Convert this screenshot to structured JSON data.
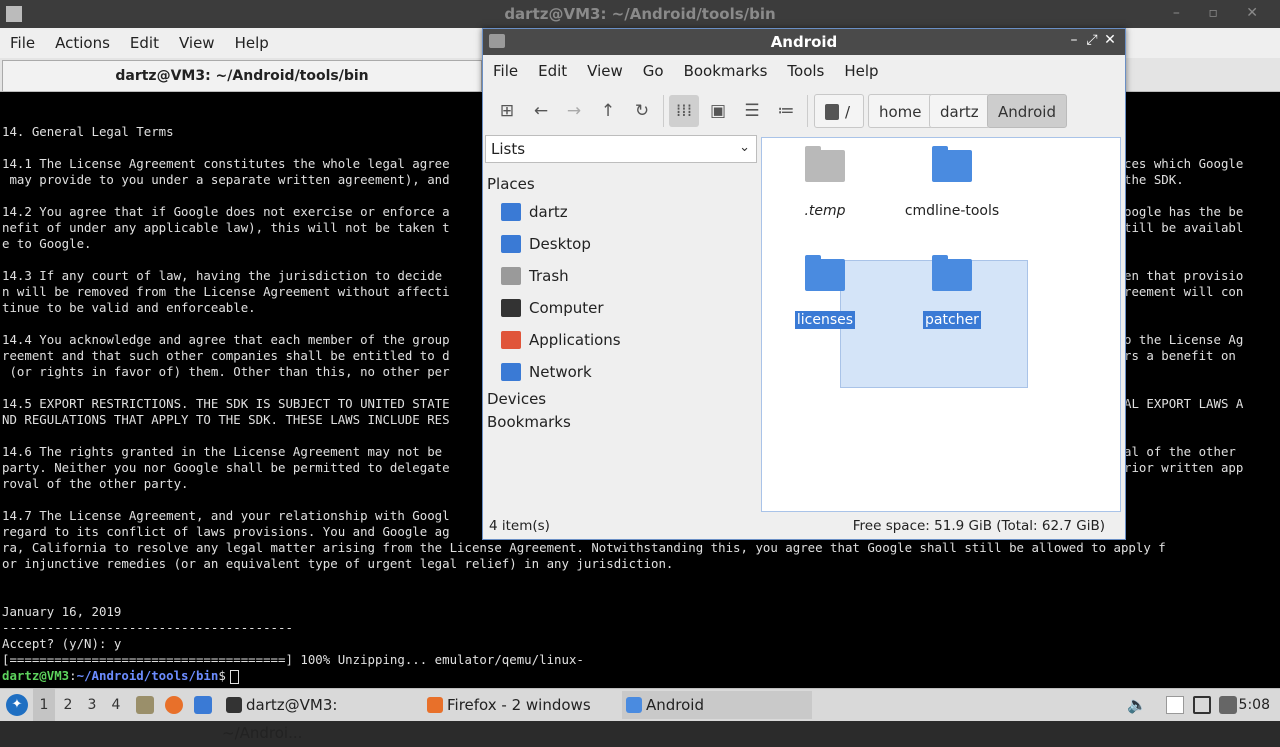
{
  "terminal": {
    "window_title": "dartz@VM3: ~/Android/tools/bin",
    "menu": [
      "File",
      "Actions",
      "Edit",
      "View",
      "Help"
    ],
    "tab_title": "dartz@VM3: ~/Android/tools/bin",
    "lines": [
      "14. General Legal Terms",
      "",
      "14.1 The License Agreement constitutes the whole legal agree",
      " may provide to you under a separate written agreement), and",
      "",
      "14.2 You agree that if Google does not exercise or enforce a",
      "nefit of under any applicable law), this will not be taken t",
      "e to Google.",
      "",
      "14.3 If any court of law, having the jurisdiction to decide ",
      "n will be removed from the License Agreement without affecti",
      "tinue to be valid and enforceable.",
      "",
      "14.4 You acknowledge and agree that each member of the group",
      "reement and that such other companies shall be entitled to d",
      " (or rights in favor of) them. Other than this, no other per",
      "",
      "14.5 EXPORT RESTRICTIONS. THE SDK IS SUBJECT TO UNITED STATE",
      "ND REGULATIONS THAT APPLY TO THE SDK. THESE LAWS INCLUDE RES",
      "",
      "14.6 The rights granted in the License Agreement may not be ",
      "party. Neither you nor Google shall be permitted to delegate",
      "roval of the other party.",
      "",
      "14.7 The License Agreement, and your relationship with Googl                                                     ifornia without",
      "regard to its conflict of laws provisions. You and Google ag                                                     nty of Santa Cla",
      "ra, California to resolve any legal matter arising from the License Agreement. Notwithstanding this, you agree that Google shall still be allowed to apply f",
      "or injunctive remedies (or an equivalent type of urgent legal relief) in any jurisdiction.",
      "",
      "",
      "January 16, 2019",
      "---------------------------------------",
      "Accept? (y/N): y",
      "[=====================================] 100% Unzipping... emulator/qemu/linux-"
    ],
    "right_fragments": [
      {
        "row": 2,
        "text": "ces which Google"
      },
      {
        "row": 3,
        "text": "the SDK."
      },
      {
        "row": 5,
        "text": "oogle has the be"
      },
      {
        "row": 6,
        "text": "till be availabl"
      },
      {
        "row": 9,
        "text": "en that provisio"
      },
      {
        "row": 10,
        "text": "reement will con"
      },
      {
        "row": 13,
        "text": "o the License Ag"
      },
      {
        "row": 14,
        "text": "rs a benefit on"
      },
      {
        "row": 17,
        "text": "AL EXPORT LAWS A"
      },
      {
        "row": 20,
        "text": "al of the other"
      },
      {
        "row": 21,
        "text": "rior written app"
      }
    ],
    "prompt_user": "dartz@VM3",
    "prompt_sep": ":",
    "prompt_path": "~/Android/tools/bin",
    "prompt_symbol": "$"
  },
  "file_manager": {
    "window_title": "Android",
    "menu": [
      "File",
      "Edit",
      "View",
      "Go",
      "Bookmarks",
      "Tools",
      "Help"
    ],
    "breadcrumb": [
      "/",
      "home",
      "dartz",
      "Android"
    ],
    "side_pane_mode": "Lists",
    "places_heading": "Places",
    "places": [
      {
        "label": "dartz",
        "icon": "home-folder-icon",
        "color": "#3a7ad5"
      },
      {
        "label": "Desktop",
        "icon": "desktop-icon",
        "color": "#3a7ad5"
      },
      {
        "label": "Trash",
        "icon": "trash-icon",
        "color": "#9a9a9a"
      },
      {
        "label": "Computer",
        "icon": "computer-icon",
        "color": "#333333"
      },
      {
        "label": "Applications",
        "icon": "applications-icon",
        "color": "#e0553a"
      },
      {
        "label": "Network",
        "icon": "network-icon",
        "color": "#3a7ad5"
      }
    ],
    "devices_heading": "Devices",
    "bookmarks_heading": "Bookmarks",
    "files": [
      {
        "name": ".temp",
        "color": "#b9b9b9",
        "italic": true,
        "selected": false
      },
      {
        "name": "cmdline-tools",
        "color": "#4a8be0",
        "italic": false,
        "selected": false
      },
      {
        "name": "licenses",
        "color": "#4a8be0",
        "italic": false,
        "selected": true
      },
      {
        "name": "patcher",
        "color": "#4a8be0",
        "italic": false,
        "selected": true
      }
    ],
    "status_left": "4 item(s)",
    "status_right": "Free space: 51.9 GiB (Total: 62.7 GiB)"
  },
  "taskbar": {
    "workspaces": [
      "1",
      "2",
      "3",
      "4"
    ],
    "tasks": [
      {
        "label": "dartz@VM3: ~/Androi...",
        "icon": "terminal-icon",
        "color": "#333333"
      },
      {
        "label": "Firefox - 2 windows",
        "icon": "firefox-icon",
        "color": "#e8702a"
      },
      {
        "label": "Android",
        "icon": "folder-icon",
        "color": "#4a8be0"
      }
    ],
    "clock": "5:08"
  }
}
